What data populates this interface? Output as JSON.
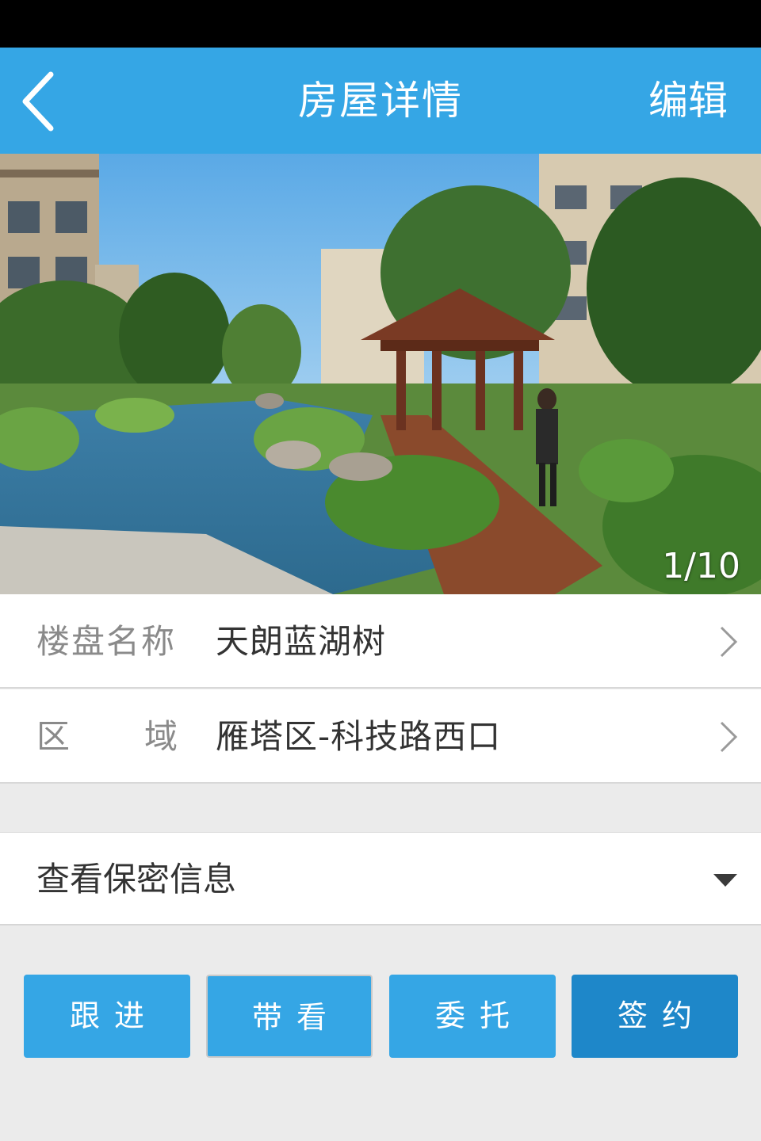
{
  "header": {
    "title": "房屋详情",
    "edit_label": "编辑",
    "back_icon": "chevron-left-icon"
  },
  "gallery": {
    "counter": "1/10"
  },
  "details": {
    "rows": [
      {
        "label": "楼盘名称",
        "value": "天朗蓝湖树"
      },
      {
        "label_part1": "区",
        "label_part2": "域",
        "value": "雁塔区-科技路西口"
      }
    ]
  },
  "secret": {
    "label": "查看保密信息"
  },
  "actions": [
    {
      "label": "跟进"
    },
    {
      "label": "带看"
    },
    {
      "label": "委托"
    },
    {
      "label": "签约"
    }
  ],
  "colors": {
    "primary": "#35a6e5",
    "primary_dark": "#1e87c9",
    "background": "#ebebeb"
  }
}
